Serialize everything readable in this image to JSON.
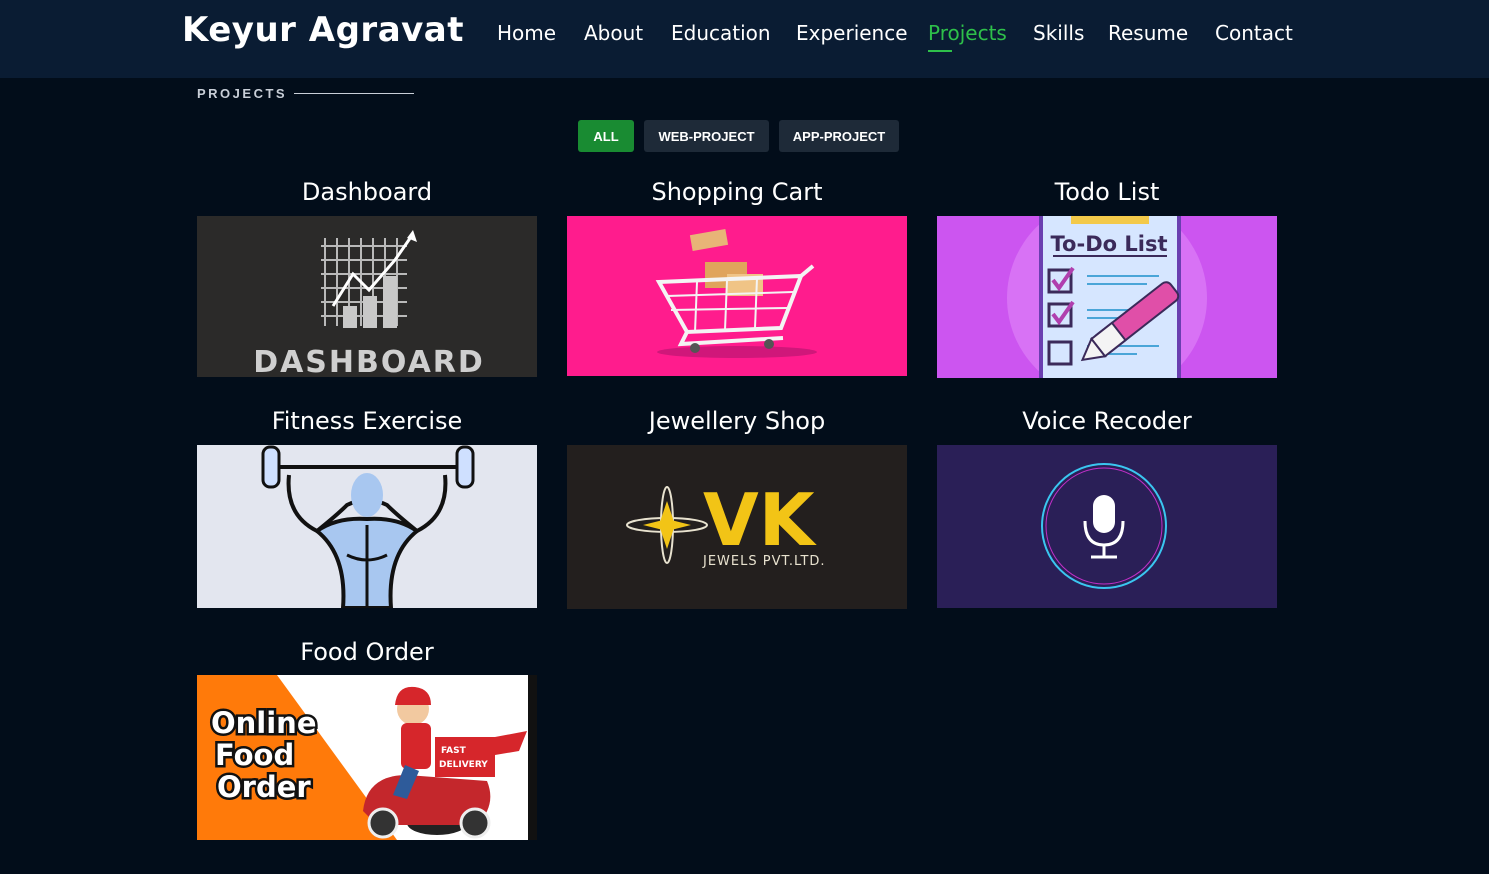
{
  "header": {
    "brand": "Keyur Agravat",
    "nav": [
      "Home",
      "About",
      "Education",
      "Experience",
      "Projects",
      "Skills",
      "Resume",
      "Contact"
    ],
    "active": "Projects"
  },
  "section": {
    "title": "PROJECTS"
  },
  "filters": [
    "ALL",
    "WEB-PROJECT",
    "APP-PROJECT"
  ],
  "projects": [
    {
      "title": "Dashboard",
      "image_text": "DASHBOARD"
    },
    {
      "title": "Shopping Cart"
    },
    {
      "title": "Todo List",
      "image_text": "To-Do List"
    },
    {
      "title": "Fitness Exercise"
    },
    {
      "title": "Jewellery Shop",
      "image_text": "VK",
      "image_subtext": "JEWELS PVT.LTD."
    },
    {
      "title": "Voice Recoder"
    },
    {
      "title": "Food Order",
      "image_text": [
        "Online",
        "Food",
        "Order"
      ],
      "badge_text": [
        "FAST",
        "DELIVERY"
      ]
    }
  ],
  "colors": {
    "accent": "#2ec04a",
    "filter_active": "#198b32",
    "navbar": "#0a1c33",
    "background": "#020d1a"
  }
}
